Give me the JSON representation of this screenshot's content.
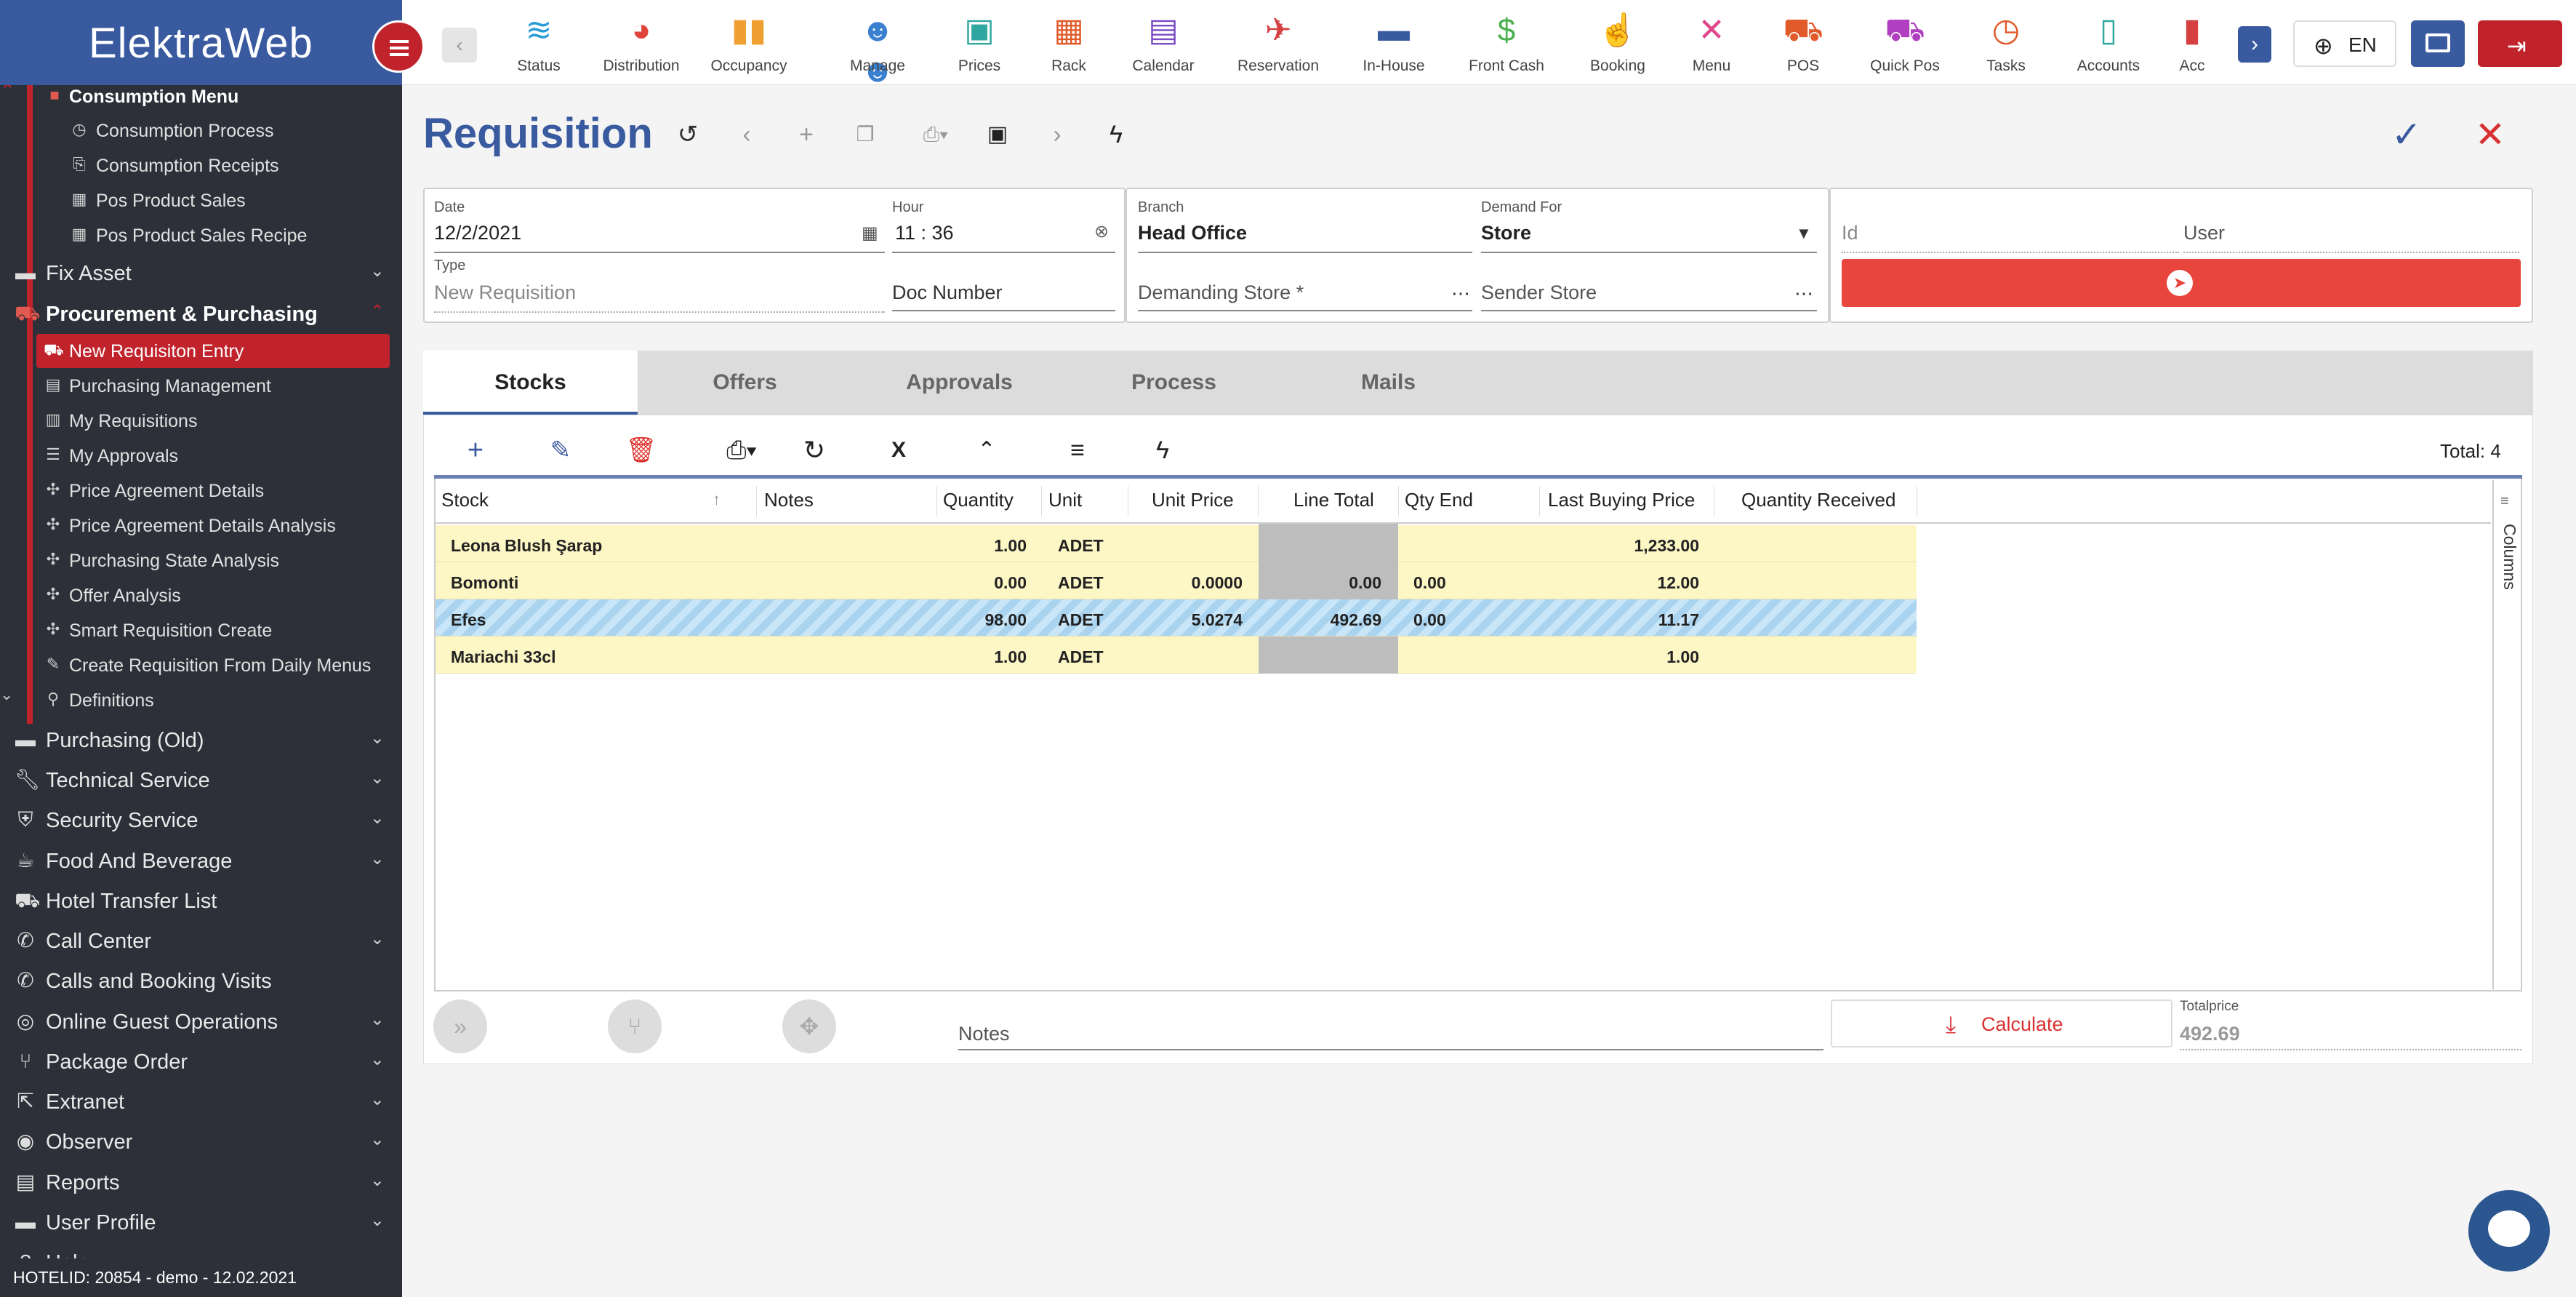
{
  "brand": {
    "name": "ElektraWeb"
  },
  "topnav": {
    "items": [
      {
        "label": "Status",
        "color": "#2b9bd6"
      },
      {
        "label": "Distribution",
        "color": "#e0443a"
      },
      {
        "label": "Occupancy",
        "color": "#f0a030"
      },
      {
        "label": "Manage",
        "color": "#3a7fd0"
      },
      {
        "label": "Prices",
        "color": "#2fa7a0"
      },
      {
        "label": "Rack",
        "color": "#e05a2a"
      },
      {
        "label": "Calendar",
        "color": "#7a4bc4"
      },
      {
        "label": "Reservation",
        "color": "#d64040"
      },
      {
        "label": "In-House",
        "color": "#3a5aa0"
      },
      {
        "label": "Front Cash",
        "color": "#4caf50"
      },
      {
        "label": "Booking",
        "color": "#e0458a"
      },
      {
        "label": "Menu",
        "color": "#e0458a"
      },
      {
        "label": "POS",
        "color": "#e05a2a"
      },
      {
        "label": "Quick Pos",
        "color": "#b040c0"
      },
      {
        "label": "Tasks",
        "color": "#e05a2a"
      },
      {
        "label": "Accounts",
        "color": "#2fa7a0"
      },
      {
        "label": "Acc",
        "color": "#d64040"
      }
    ],
    "lang": "EN"
  },
  "sidebar": {
    "consumption_menu": "Consumption Menu",
    "consumption_items": [
      "Consumption Process",
      "Consumption Receipts",
      "Pos Product Sales",
      "Pos Product Sales Recipe"
    ],
    "fix_asset": "Fix Asset",
    "procurement": "Procurement & Purchasing",
    "procurement_items": [
      "New Requisiton Entry",
      "Purchasing Management",
      "My Requisitions",
      "My Approvals",
      "Price Agreement Details",
      "Price Agreement Details Analysis",
      "Purchasing State Analysis",
      "Offer Analysis",
      "Smart Requisition Create",
      "Create Requisition From Daily Menus",
      "Definitions"
    ],
    "sections": [
      "Purchasing (Old)",
      "Technical Service",
      "Security Service",
      "Food And Beverage",
      "Hotel Transfer List",
      "Call Center",
      "Calls and Booking Visits",
      "Online Guest Operations",
      "Package Order",
      "Extranet",
      "Observer",
      "Reports",
      "User Profile",
      "Help"
    ],
    "footer": "HOTELID: 20854 - demo - 12.02.2021"
  },
  "page": {
    "title": "Requisition"
  },
  "form": {
    "date_label": "Date",
    "date_value": "12/2/2021",
    "hour_label": "Hour",
    "hour_value": "11 : 36",
    "type_label": "Type",
    "type_value": "New Requisition",
    "doc_number": "Doc Number",
    "branch_label": "Branch",
    "branch_value": "Head Office",
    "demand_for_label": "Demand For",
    "demand_for_value": "Store",
    "demanding_store": "Demanding Store *",
    "sender_store": "Sender Store",
    "id_label": "Id",
    "user_label": "User"
  },
  "tabs": [
    "Stocks",
    "Offers",
    "Approvals",
    "Process",
    "Mails"
  ],
  "grid": {
    "total": "Total: 4",
    "columns": [
      "Stock",
      "Notes",
      "Quantity",
      "Unit",
      "Unit Price",
      "Line Total",
      "Qty End",
      "Last Buying Price",
      "Quantity Received"
    ],
    "rows": [
      {
        "stock": "Leona Blush Şarap",
        "notes": "",
        "quantity": "1.00",
        "unit": "ADET",
        "unit_price": "",
        "line_total": "",
        "qty_end": "",
        "last_buying_price": "1,233.00",
        "quantity_received": ""
      },
      {
        "stock": "Bomonti",
        "notes": "",
        "quantity": "0.00",
        "unit": "ADET",
        "unit_price": "0.0000",
        "line_total": "0.00",
        "qty_end": "0.00",
        "last_buying_price": "12.00",
        "quantity_received": ""
      },
      {
        "stock": "Efes",
        "notes": "",
        "quantity": "98.00",
        "unit": "ADET",
        "unit_price": "5.0274",
        "line_total": "492.69",
        "qty_end": "0.00",
        "last_buying_price": "11.17",
        "quantity_received": ""
      },
      {
        "stock": "Mariachi 33cl",
        "notes": "",
        "quantity": "1.00",
        "unit": "ADET",
        "unit_price": "",
        "line_total": "",
        "qty_end": "",
        "last_buying_price": "1.00",
        "quantity_received": ""
      }
    ],
    "columns_side": "Columns"
  },
  "footer": {
    "notes_placeholder": "Notes",
    "calculate": "Calculate",
    "totalprice_label": "Totalprice",
    "totalprice_value": "492.69"
  },
  "colors": {
    "accent": "#3a5aa0",
    "danger": "#c0232b",
    "highlight_row": "#fdf6c5"
  }
}
